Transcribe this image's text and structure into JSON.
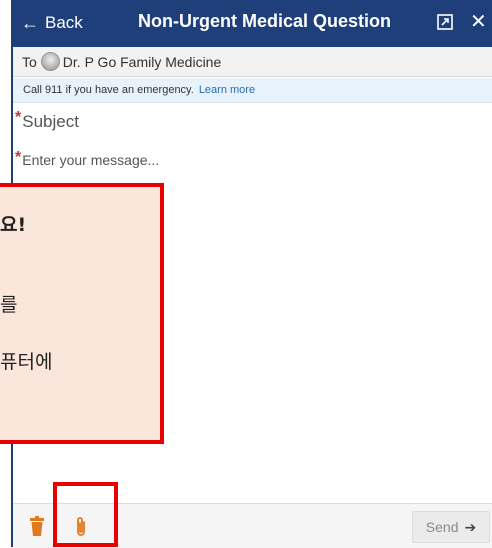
{
  "header": {
    "back_label": "Back",
    "title": "Non-Urgent Medical Question"
  },
  "to_row": {
    "to_label": "To",
    "recipient": "Dr. P Go Family Medicine"
  },
  "notice": {
    "text": "Call 911 if you have an emergency.",
    "link": "Learn more"
  },
  "form": {
    "required_marker": "*",
    "subject_placeholder": "Subject",
    "message_placeholder": "Enter your message..."
  },
  "footer": {
    "send_label": "Send"
  },
  "tooltip": {
    "line1": "요!",
    "line2": "를",
    "line3": "퓨터에"
  },
  "colors": {
    "header_bg": "#1f3f7a",
    "accent_red": "#e60000",
    "tooltip_bg": "#fbe6dc",
    "trash_orange": "#e07a1f",
    "link_blue": "#2a6db3"
  }
}
